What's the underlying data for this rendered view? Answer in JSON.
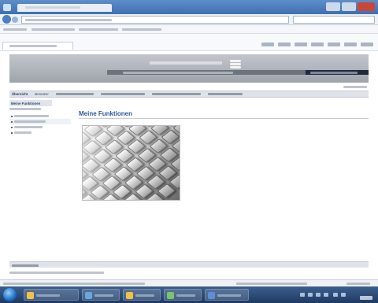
{
  "browser": {
    "tab_title": "",
    "address": "",
    "status": ""
  },
  "page": {
    "banner_name": "",
    "banner_subtitle": "",
    "banner_right": "",
    "util_links": "",
    "menu": [
      {
        "label": "Übersicht"
      },
      {
        "label": "Benutzer"
      },
      {
        "label": ""
      },
      {
        "label": ""
      },
      {
        "label": ""
      },
      {
        "label": ""
      }
    ],
    "sidebar": {
      "heading": "Meine Funktionen",
      "sub": "",
      "items": [
        {
          "label": ""
        },
        {
          "label": ""
        },
        {
          "label": ""
        },
        {
          "label": ""
        }
      ]
    },
    "main": {
      "title": "Meine Funktionen"
    },
    "footer": {
      "label": "",
      "note": ""
    }
  },
  "taskbar": {
    "buttons": [
      {
        "label": ""
      },
      {
        "label": ""
      },
      {
        "label": ""
      },
      {
        "label": ""
      },
      {
        "label": ""
      }
    ],
    "clock": ""
  }
}
